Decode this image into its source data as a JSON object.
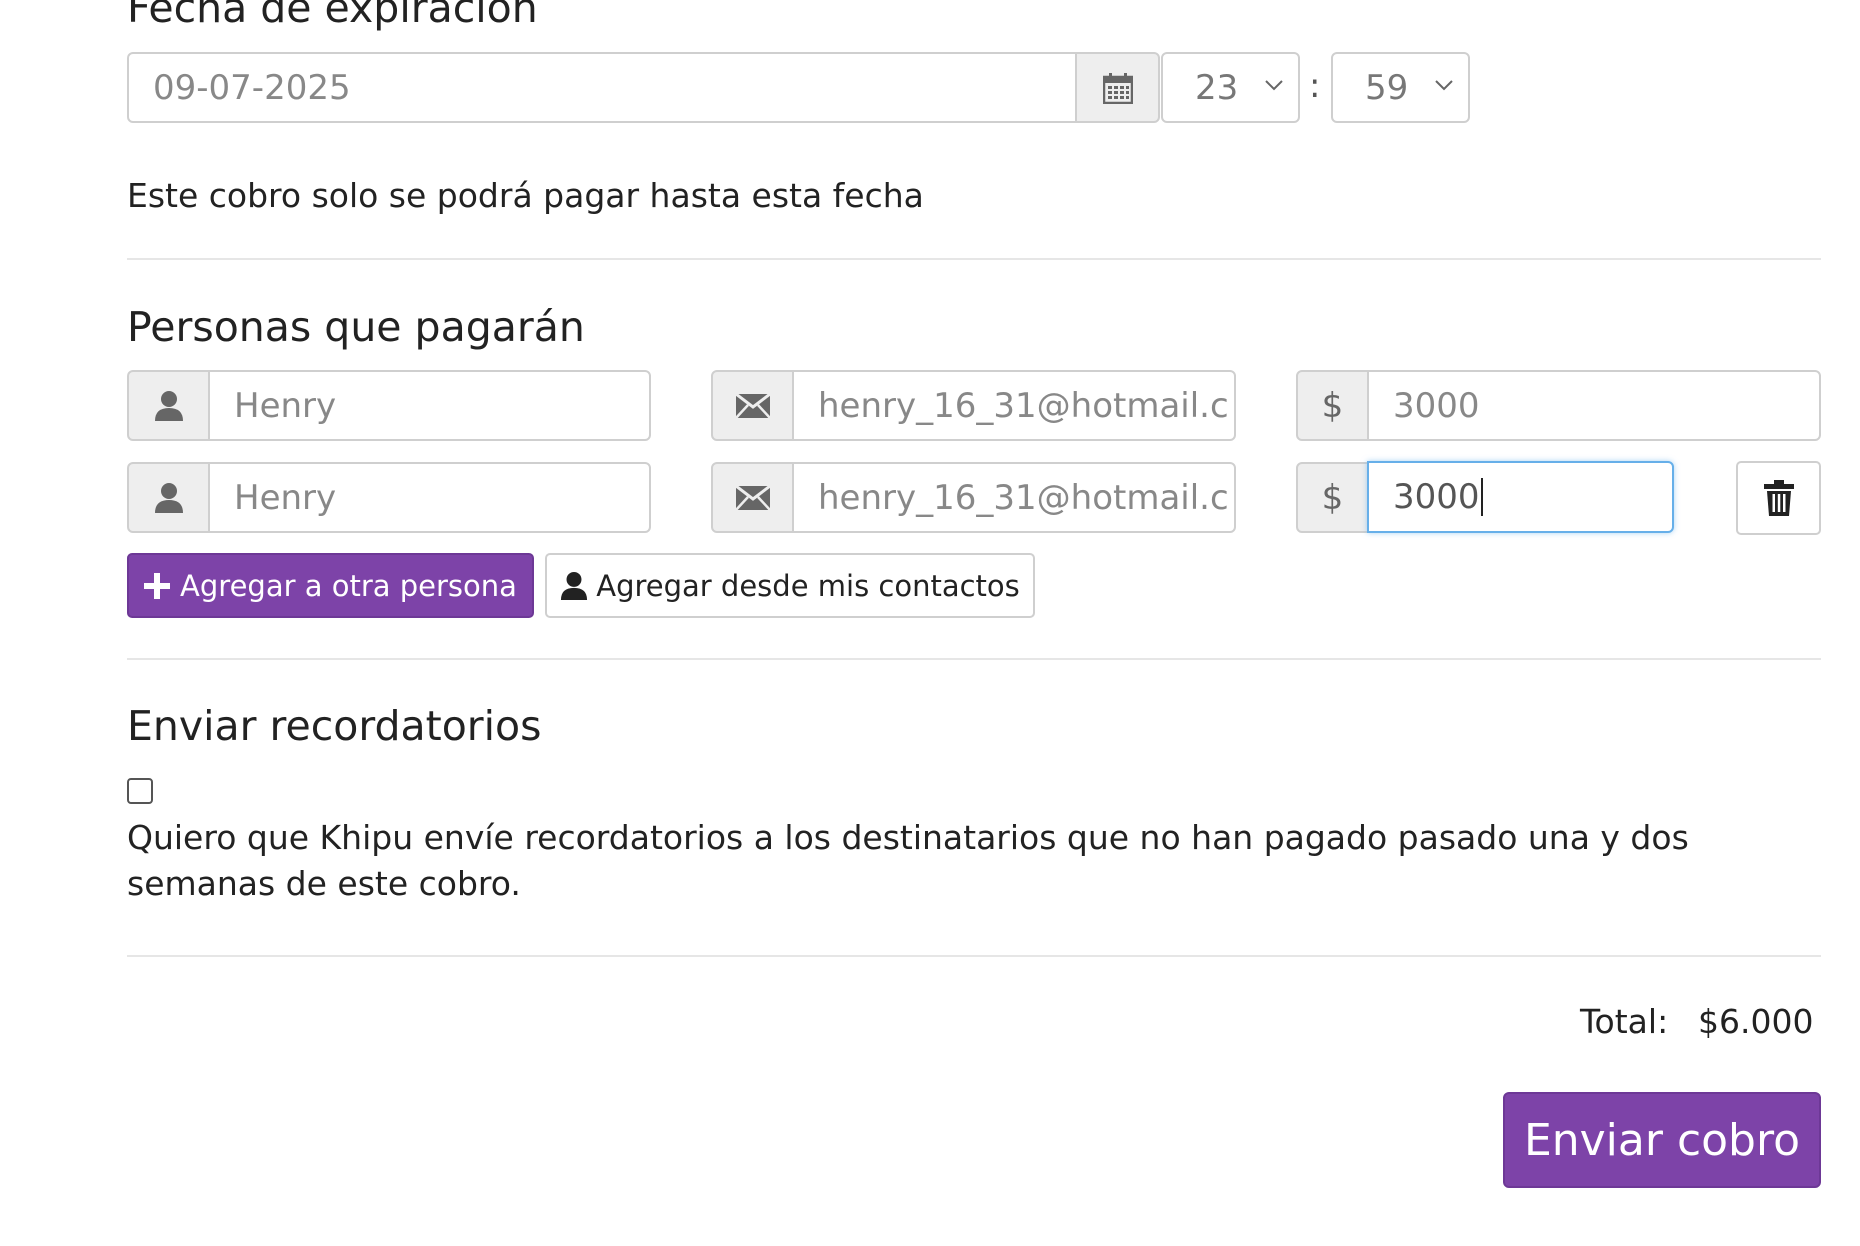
{
  "expiration": {
    "heading": "Fecha de expiración",
    "date_value": "09-07-2025",
    "hour_value": "23",
    "time_separator": ":",
    "minute_value": "59",
    "help_text": "Este cobro solo se podrá pagar hasta esta fecha"
  },
  "payers": {
    "heading": "Personas que pagarán",
    "currency_symbol": "$",
    "rows": [
      {
        "name": "Henry",
        "email": "henry_16_31@hotmail.c",
        "amount": "3000"
      },
      {
        "name": "Henry",
        "email": "henry_16_31@hotmail.c",
        "amount": "3000"
      }
    ],
    "add_person_label": "Agregar a otra persona",
    "add_contacts_label": "Agregar desde mis contactos"
  },
  "reminders": {
    "heading": "Enviar recordatorios",
    "description": "Quiero que Khipu envíe recordatorios a los destinatarios que no han pagado pasado una y dos semanas de este cobro.",
    "checked": false
  },
  "summary": {
    "total_label": "Total:",
    "total_value": "$6.000"
  },
  "submit_label": "Enviar cobro",
  "colors": {
    "primary": "#7d43a8",
    "focus_border": "#66afe9",
    "addon_bg": "#eeeeee"
  }
}
